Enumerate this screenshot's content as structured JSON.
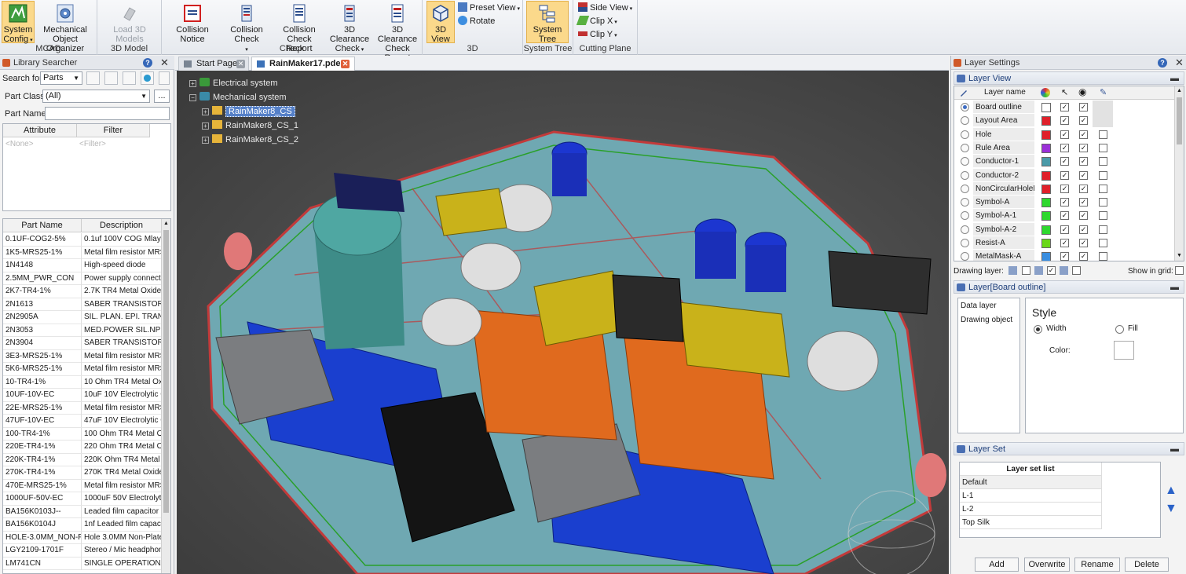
{
  "ribbon": {
    "groups": [
      {
        "label": "MCAD",
        "buttons": [
          "System Config",
          "Mechanical Object Organizer"
        ]
      },
      {
        "label": "3D Model",
        "buttons": [
          "Load 3D Models"
        ]
      },
      {
        "label": "Check",
        "buttons": [
          "Collision Notice",
          "Collision Check",
          "Collision Check Report",
          "3D Clearance Check",
          "3D Clearance Check Report"
        ]
      },
      {
        "label": "3D",
        "buttons": [
          "3D View"
        ],
        "small": [
          "Preset View",
          "Rotate"
        ]
      },
      {
        "label": "System Tree",
        "buttons": [
          "System Tree"
        ]
      },
      {
        "label": "Cutting Plane",
        "small": [
          "Side View",
          "Clip X",
          "Clip Y"
        ]
      }
    ],
    "system_config_l1": "System",
    "system_config_l2": "Config",
    "mech_l1": "Mechanical",
    "mech_l2": "Object Organizer",
    "load3d": "Load 3D Models",
    "collision_notice": "Collision Notice",
    "collision_check": "Collision Check",
    "cc_report_l1": "Collision Check",
    "cc_report_l2": "Report",
    "clear_check_l1": "3D Clearance",
    "clear_check_l2": "Check",
    "clear_report_l1": "3D Clearance",
    "clear_report_l2": "Check Report",
    "view3d": "3D View",
    "preset_view": "Preset View",
    "rotate": "Rotate",
    "system_tree": "System Tree",
    "side_view": "Side View",
    "clip_x": "Clip X",
    "clip_y": "Clip Y",
    "label_mcad": "MCAD",
    "label_3dmodel": "3D Model",
    "label_check": "Check",
    "label_3d": "3D",
    "label_systree": "System Tree",
    "label_cutting": "Cutting Plane"
  },
  "library": {
    "title": "Library Searcher",
    "search_for_label": "Search for:",
    "search_for_value": "Parts",
    "part_class_label": "Part Class:",
    "part_class_value": "(All)",
    "part_name_label": "Part Name:",
    "part_name_value": "",
    "more_button": "...",
    "attr_headers": [
      "Attribute",
      "Filter"
    ],
    "attr_placeholder": "<None>",
    "filter_placeholder": "<Filter>",
    "parts_headers": [
      "Part Name",
      "Description"
    ],
    "parts": [
      [
        "0.1UF-COG2-5%",
        "0.1uf 100V COG Mlayer"
      ],
      [
        "1K5-MRS25-1%",
        "Metal film resistor MRS"
      ],
      [
        "1N4148",
        "High-speed diode"
      ],
      [
        "2.5MM_PWR_CON",
        "Power supply connecto"
      ],
      [
        "2K7-TR4-1%",
        "2.7K TR4 Metal Oxide F"
      ],
      [
        "2N1613",
        "SABER TRANSISTOR"
      ],
      [
        "2N2905A",
        "SIL. PLAN. EPI. TRANSI"
      ],
      [
        "2N3053",
        "MED.POWER SIL.NPN F"
      ],
      [
        "2N3904",
        "SABER TRANSISTOR"
      ],
      [
        "3E3-MRS25-1%",
        "Metal film resistor MRS"
      ],
      [
        "5K6-MRS25-1%",
        "Metal film resistor MRS"
      ],
      [
        "10-TR4-1%",
        "10 Ohm TR4 Metal Oxi"
      ],
      [
        "10UF-10V-EC",
        "10uF 10V Electrolytic C"
      ],
      [
        "22E-MRS25-1%",
        "Metal film resistor MRS"
      ],
      [
        "47UF-10V-EC",
        "47uF 10V Electrolytic C"
      ],
      [
        "100-TR4-1%",
        "100 Ohm TR4 Metal Ox"
      ],
      [
        "220E-TR4-1%",
        "220 Ohm TR4 Metal Ox"
      ],
      [
        "220K-TR4-1%",
        "220K Ohm TR4 Metal C"
      ],
      [
        "270K-TR4-1%",
        "270K TR4 Metal Oxide F"
      ],
      [
        "470E-MRS25-1%",
        "Metal film resistor MRS"
      ],
      [
        "1000UF-50V-EC",
        "1000uF 50V Electrolytic"
      ],
      [
        "BA156K0103J--",
        "Leaded film capacitor"
      ],
      [
        "BA156K0104J",
        "1nf Leaded film capacit"
      ],
      [
        "HOLE-3.0MM_NON-PL",
        "Hole 3.0MM Non-Plate"
      ],
      [
        "LGY2109-1701F",
        "Stereo / Mic headphon"
      ],
      [
        "LM741CN",
        "SINGLE OPERATIONAL"
      ]
    ]
  },
  "tabs": [
    "Start Page",
    "RainMaker17.pdes*"
  ],
  "tree": {
    "electrical": "Electrical system",
    "mechanical": "Mechanical system",
    "children": [
      "RainMaker8_CS",
      "RainMaker8_CS_1",
      "RainMaker8_CS_2"
    ]
  },
  "layers": {
    "title": "Layer Settings",
    "layer_view": "Layer View",
    "layer_name_header": "Layer name",
    "rows": [
      {
        "name": "Board outline",
        "color": "#ffffff",
        "selected": true,
        "pen": true,
        "eye": true,
        "grid": null
      },
      {
        "name": "Layout Area",
        "color": "#e0202a",
        "selected": false,
        "pen": true,
        "eye": true,
        "grid": null
      },
      {
        "name": "Hole",
        "color": "#e0202a",
        "selected": false,
        "pen": true,
        "eye": true,
        "grid": false
      },
      {
        "name": "Rule Area",
        "color": "#9b30d8",
        "selected": false,
        "pen": true,
        "eye": true,
        "grid": false
      },
      {
        "name": "Conductor-1",
        "color": "#4a9aa8",
        "selected": false,
        "pen": true,
        "eye": true,
        "grid": false
      },
      {
        "name": "Conductor-2",
        "color": "#e0202a",
        "selected": false,
        "pen": true,
        "eye": true,
        "grid": false
      },
      {
        "name": "NonCircularHoleL",
        "color": "#e0202a",
        "selected": false,
        "pen": true,
        "eye": true,
        "grid": false
      },
      {
        "name": "Symbol-A",
        "color": "#2ed82e",
        "selected": false,
        "pen": true,
        "eye": true,
        "grid": false
      },
      {
        "name": "Symbol-A-1",
        "color": "#2ed82e",
        "selected": false,
        "pen": true,
        "eye": true,
        "grid": false
      },
      {
        "name": "Symbol-A-2",
        "color": "#2ed82e",
        "selected": false,
        "pen": true,
        "eye": true,
        "grid": false
      },
      {
        "name": "Resist-A",
        "color": "#6ad818",
        "selected": false,
        "pen": true,
        "eye": true,
        "grid": false
      },
      {
        "name": "MetalMask-A",
        "color": "#3a8ee0",
        "selected": false,
        "pen": true,
        "eye": true,
        "grid": false
      }
    ],
    "drawing_layer_label": "Drawing layer:",
    "show_in_grid_label": "Show in grid:",
    "board_title": "Layer[Board outline]",
    "data_layer": "Data layer",
    "drawing_object": "Drawing object",
    "style_label": "Style",
    "width_label": "Width",
    "fill_label": "Fill",
    "color_label": "Color:",
    "layer_set_title": "Layer Set",
    "layer_set_header": "Layer set list",
    "layer_sets": [
      "Default",
      "L-1",
      "L-2",
      "Top Silk"
    ],
    "buttons": [
      "Add",
      "Overwrite",
      "Rename",
      "Delete"
    ]
  }
}
